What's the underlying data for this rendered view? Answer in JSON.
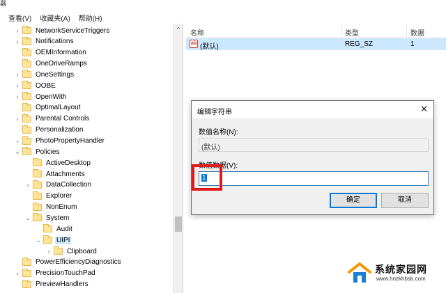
{
  "window": {
    "title_fragment": "器"
  },
  "menu": [
    {
      "label": "查看(V)"
    },
    {
      "label": "收藏夹(A)"
    },
    {
      "label": "帮助(H)"
    }
  ],
  "tree": {
    "items": [
      {
        "label": "NetworkServiceTriggers",
        "level": 1,
        "expandable": true
      },
      {
        "label": "Notifications",
        "level": 1,
        "expandable": true
      },
      {
        "label": "OEMInformation",
        "level": 1,
        "expandable": false
      },
      {
        "label": "OneDriveRamps",
        "level": 1,
        "expandable": false
      },
      {
        "label": "OneSettings",
        "level": 1,
        "expandable": true
      },
      {
        "label": "OOBE",
        "level": 1,
        "expandable": true
      },
      {
        "label": "OpenWith",
        "level": 1,
        "expandable": true
      },
      {
        "label": "OptimalLayout",
        "level": 1,
        "expandable": false
      },
      {
        "label": "Parental Controls",
        "level": 1,
        "expandable": true
      },
      {
        "label": "Personalization",
        "level": 1,
        "expandable": false
      },
      {
        "label": "PhotoPropertyHandler",
        "level": 1,
        "expandable": true
      },
      {
        "label": "Policies",
        "level": 1,
        "expandable": true,
        "expanded": true
      },
      {
        "label": "ActiveDesktop",
        "level": 2,
        "expandable": false
      },
      {
        "label": "Attachments",
        "level": 2,
        "expandable": false
      },
      {
        "label": "DataCollection",
        "level": 2,
        "expandable": true
      },
      {
        "label": "Explorer",
        "level": 2,
        "expandable": false
      },
      {
        "label": "NonEnum",
        "level": 2,
        "expandable": false
      },
      {
        "label": "System",
        "level": 2,
        "expandable": true,
        "expanded": true
      },
      {
        "label": "Audit",
        "level": 3,
        "expandable": false
      },
      {
        "label": "UIPI",
        "level": 3,
        "expandable": true,
        "expanded": true,
        "selected": true
      },
      {
        "label": "Clipboard",
        "level": 4,
        "expandable": true
      },
      {
        "label": "PowerEfficiencyDiagnostics",
        "level": 1,
        "expandable": false
      },
      {
        "label": "PrecisionTouchPad",
        "level": 1,
        "expandable": true
      },
      {
        "label": "PreviewHandlers",
        "level": 1,
        "expandable": false
      }
    ]
  },
  "list": {
    "columns": {
      "name": "名称",
      "type": "类型",
      "data": "数据"
    },
    "rows": [
      {
        "icon": "string-value-icon",
        "icon_text": "ab",
        "name": "(默认)",
        "type": "REG_SZ",
        "data": "1"
      }
    ]
  },
  "dialog": {
    "title": "编辑字符串",
    "close_glyph": "✕",
    "name_label": "数值名称(N):",
    "name_value": "(默认)",
    "data_label": "数值数据(V):",
    "data_value": "1",
    "ok_label": "确定",
    "cancel_label": "取消"
  },
  "watermark": {
    "site_name": "系统家园网",
    "url": "www.hnzkhbsb.com"
  },
  "colors": {
    "selection": "#cce8ff",
    "highlight_box": "#e01b1b",
    "accent": "#0078d7"
  }
}
